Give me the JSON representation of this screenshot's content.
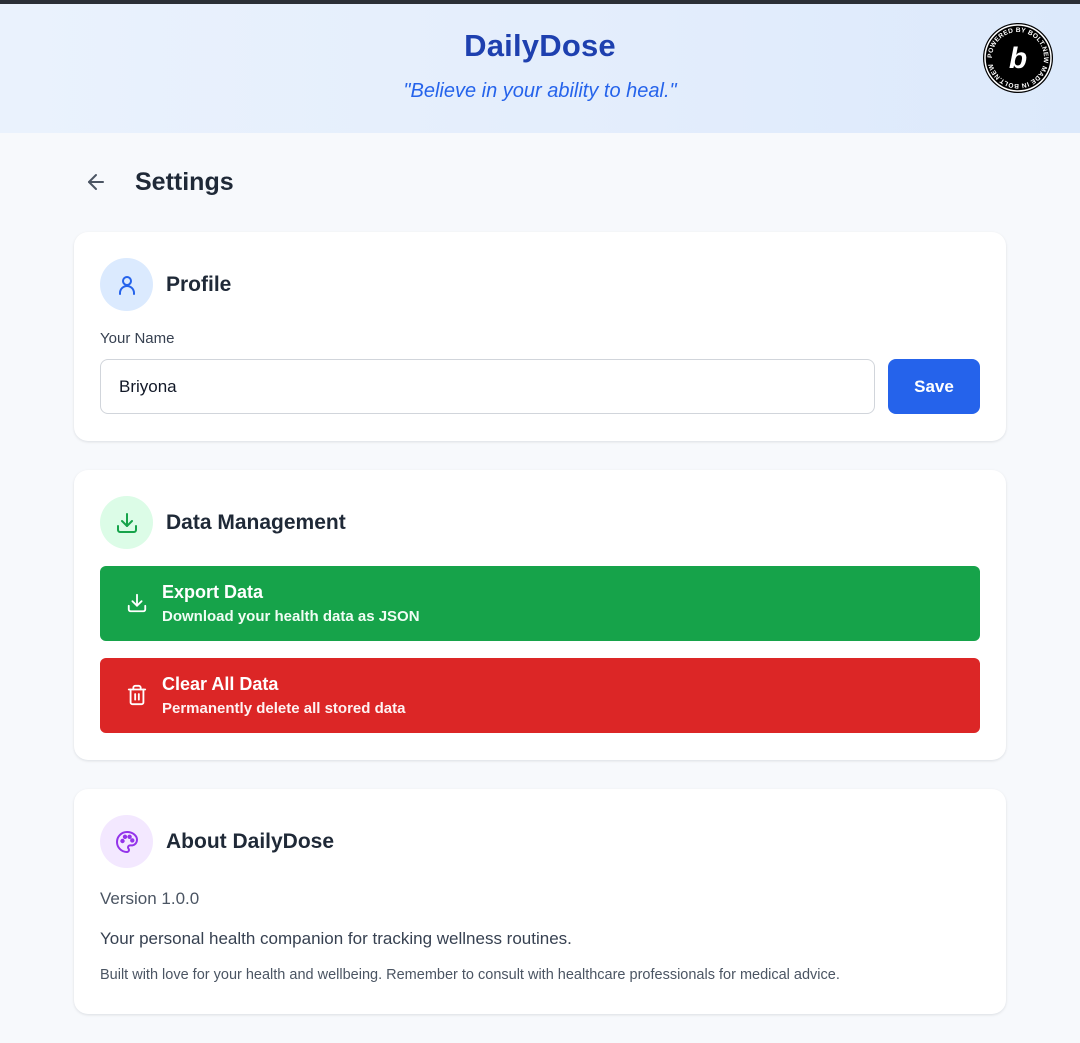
{
  "header": {
    "app_title": "DailyDose",
    "tagline": "\"Believe in your ability to heal.\"",
    "badge_text": "POWERED BY BOLT.NEW MADE IN BOLT.NEW",
    "badge_letter": "b"
  },
  "page": {
    "title": "Settings",
    "back_icon": "arrow-left-icon"
  },
  "profile": {
    "title": "Profile",
    "icon": "user-icon",
    "name_label": "Your Name",
    "name_value": "Briyona",
    "save_label": "Save"
  },
  "data_management": {
    "title": "Data Management",
    "icon": "download-icon",
    "export": {
      "title": "Export Data",
      "subtitle": "Download your health data as JSON",
      "icon": "download-icon"
    },
    "clear": {
      "title": "Clear All Data",
      "subtitle": "Permanently delete all stored data",
      "icon": "trash-icon"
    }
  },
  "about": {
    "title": "About DailyDose",
    "icon": "palette-icon",
    "version": "Version 1.0.0",
    "description": "Your personal health companion for tracking wellness routines.",
    "note": "Built with love for your health and wellbeing. Remember to consult with healthcare professionals for medical advice."
  },
  "colors": {
    "primary": "#2563eb",
    "title_blue": "#1e40af",
    "export_green": "#16a34a",
    "clear_red": "#dc2626",
    "background": "#f7f9fc"
  }
}
